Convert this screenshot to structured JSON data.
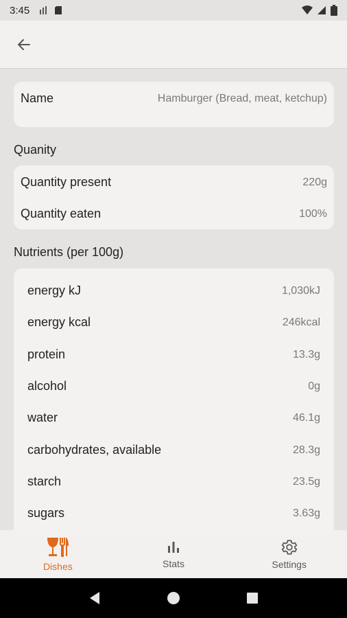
{
  "status": {
    "time": "3:45"
  },
  "header": {
    "back_icon": "arrow-left-icon"
  },
  "dish": {
    "name_label": "Name",
    "name_value": "Hamburger (Bread, meat, ketchup)"
  },
  "quantity": {
    "title": "Quanity",
    "present_label": "Quantity present",
    "present_value": "220g",
    "eaten_label": "Quantity eaten",
    "eaten_value": "100%"
  },
  "nutrients": {
    "title": "Nutrients (per 100g)",
    "items": [
      {
        "label": "energy kJ",
        "value": "1,030kJ"
      },
      {
        "label": "energy kcal",
        "value": "246kcal"
      },
      {
        "label": "protein",
        "value": "13.3g"
      },
      {
        "label": "alcohol",
        "value": "0g"
      },
      {
        "label": "water",
        "value": "46.1g"
      },
      {
        "label": "carbohydrates, available",
        "value": "28.3g"
      },
      {
        "label": "starch",
        "value": "23.5g"
      },
      {
        "label": "sugars",
        "value": "3.63g"
      }
    ]
  },
  "nav": {
    "items": [
      {
        "label": "Dishes",
        "icon": "dishes-icon",
        "active": true
      },
      {
        "label": "Stats",
        "icon": "bar-chart-icon",
        "active": false
      },
      {
        "label": "Settings",
        "icon": "gear-icon",
        "active": false
      }
    ]
  },
  "colors": {
    "accent": "#e06a1b",
    "background": "#e4e3e2",
    "card": "#f3f2f1"
  }
}
